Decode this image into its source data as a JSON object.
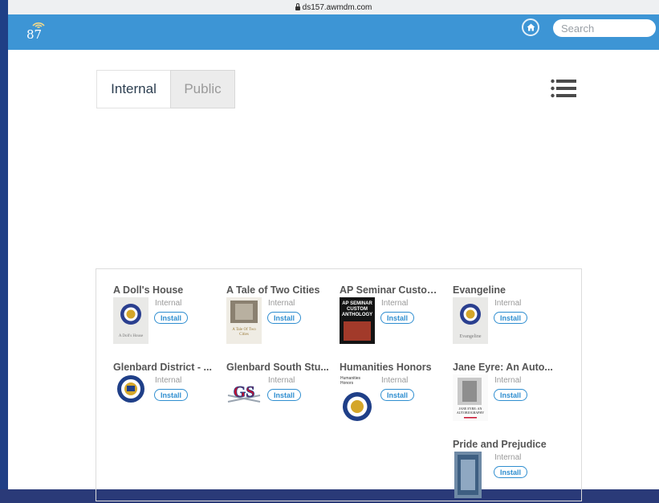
{
  "browser": {
    "url": "ds157.awmdm.com"
  },
  "header": {
    "logo_text": "87",
    "search_placeholder": "Search"
  },
  "tabs": [
    {
      "label": "Internal"
    },
    {
      "label": "Public"
    }
  ],
  "apps": [
    {
      "title": "A Doll's House",
      "badge": "Internal",
      "action": "Install",
      "cover_text": "A Doll's House"
    },
    {
      "title": "A Tale of Two Cities",
      "badge": "Internal",
      "action": "Install",
      "cover_text": "A Tale Of Two Cities"
    },
    {
      "title": "AP Seminar Custom...",
      "badge": "Internal",
      "action": "Install",
      "cover_text": "AP SEMINAR CUSTOM ANTHOLOGY"
    },
    {
      "title": "Evangeline",
      "badge": "Internal",
      "action": "Install",
      "cover_text": "Evangeline"
    },
    {
      "title": "Glenbard District - ...",
      "badge": "Internal",
      "action": "Install",
      "cover_text": ""
    },
    {
      "title": "Glenbard South Stu...",
      "badge": "Internal",
      "action": "Install",
      "cover_text": ""
    },
    {
      "title": "Humanities Honors",
      "badge": "Internal",
      "action": "Install",
      "cover_text": "Humanities Honors"
    },
    {
      "title": "Jane Eyre: An Auto...",
      "badge": "Internal",
      "action": "Install",
      "cover_text": "JANE EYRE: AN AUTOBIOGRAPHY"
    },
    {
      "title": "Pride and Prejudice",
      "badge": "Internal",
      "action": "Install",
      "cover_text": ""
    }
  ],
  "colors": {
    "header": "#3d95d5",
    "accent": "#2f8ed0"
  }
}
